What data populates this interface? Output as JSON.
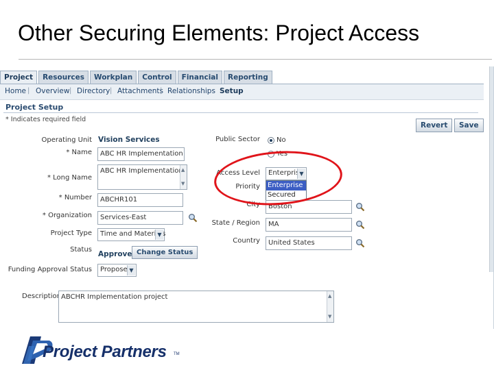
{
  "slide": {
    "title": "Other Securing Elements: Project Access",
    "logo_text": "Project Partners",
    "logo_tm": "TM"
  },
  "tabs": [
    "Project",
    "Resources",
    "Workplan",
    "Control",
    "Financial",
    "Reporting"
  ],
  "subnav": [
    "Home",
    "Overview",
    "Directory",
    "Attachments",
    "Relationships",
    "Setup"
  ],
  "page": {
    "heading": "Project Setup",
    "required_note": "* Indicates required field"
  },
  "buttons": {
    "revert": "Revert",
    "save": "Save",
    "change_status": "Change Status"
  },
  "form": {
    "operating_unit_label": "Operating Unit",
    "operating_unit_value": "Vision Services",
    "name_label": "* Name",
    "name_value": "ABC HR Implementation",
    "long_name_label": "* Long Name",
    "long_name_value": "ABC HR Implementation",
    "number_label": "* Number",
    "number_value": "ABCHR101",
    "organization_label": "* Organization",
    "organization_value": "Services-East",
    "project_type_label": "Project Type",
    "project_type_value": "Time and Materials",
    "status_label": "Status",
    "status_value": "Approved",
    "funding_label": "Funding Approval Status",
    "funding_value": "Proposed",
    "description_label": "Description",
    "description_value": "ABCHR Implementation project",
    "public_sector_label": "Public Sector",
    "public_sector_options": [
      "No",
      "Yes"
    ],
    "access_level_label": "Access Level",
    "access_level_value": "Enterprise",
    "access_level_options": [
      "Enterprise",
      "Secured"
    ],
    "priority_label": "Priority",
    "city_label": "City",
    "city_value": "Boston",
    "state_label": "State / Region",
    "state_value": "MA",
    "country_label": "Country",
    "country_value": "United States"
  },
  "icons": {
    "lookup": "magnifier-icon",
    "dropdown": "chevron-down-icon"
  },
  "colors": {
    "tab_bg": "#d6dde5",
    "tab_text": "#274b70",
    "callout": "#e0141a",
    "highlight": "#3c5ec4",
    "logo": "#16306a"
  }
}
